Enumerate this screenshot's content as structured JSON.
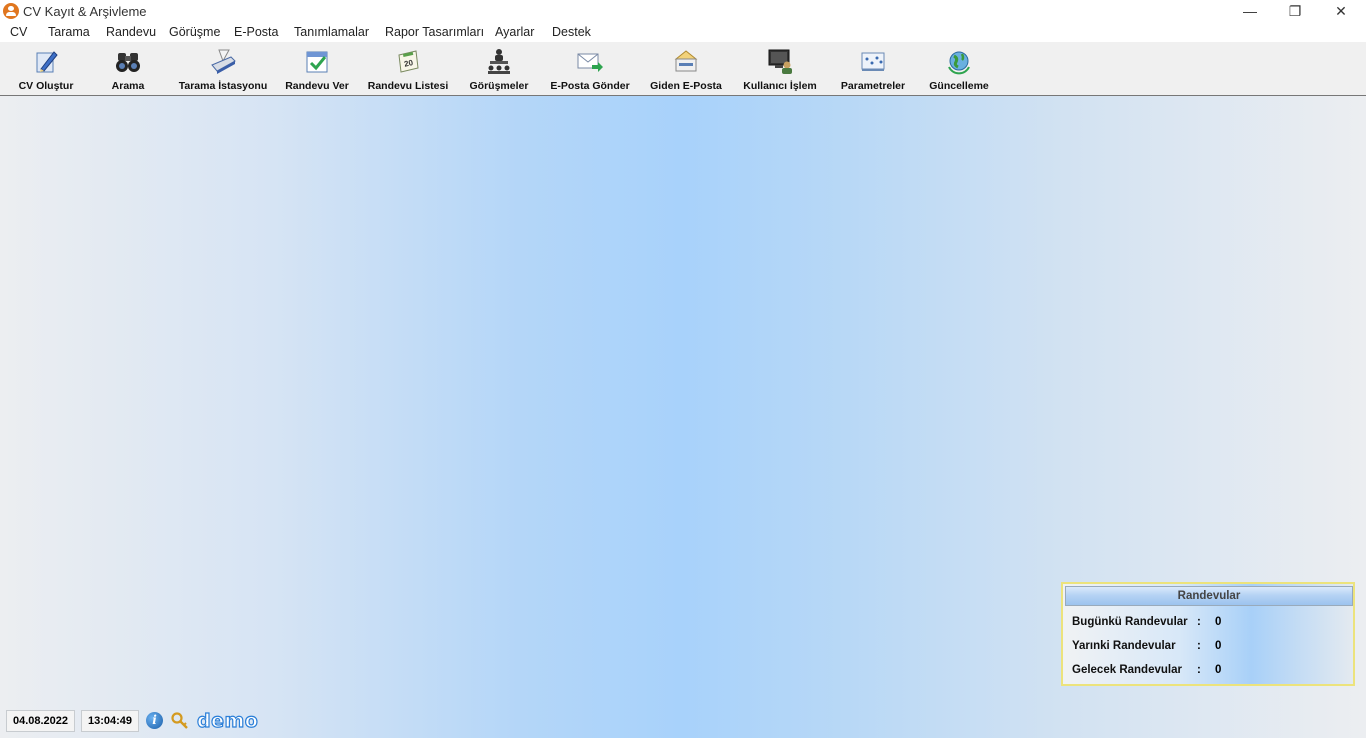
{
  "window": {
    "title": "CV Kayıt & Arşivleme",
    "minimize": "—",
    "restore": "❐",
    "close": "✕"
  },
  "menu": [
    "CV",
    "Tarama",
    "Randevu",
    "Görüşme",
    "E-Posta",
    "Tanımlamalar",
    "Rapor Tasarımları",
    "Ayarlar",
    "Destek"
  ],
  "toolbar": [
    {
      "label": "CV Oluştur",
      "icon": "pencil-doc-icon"
    },
    {
      "label": "Arama",
      "icon": "binoculars-icon"
    },
    {
      "label": "Tarama İstasyonu",
      "icon": "scanner-icon"
    },
    {
      "label": "Randevu Ver",
      "icon": "calendar-check-icon"
    },
    {
      "label": "Randevu Listesi",
      "icon": "calendar-list-icon"
    },
    {
      "label": "Görüşmeler",
      "icon": "meeting-icon"
    },
    {
      "label": "E-Posta Gönder",
      "icon": "mail-send-icon"
    },
    {
      "label": "Giden E-Posta",
      "icon": "mail-outbox-icon"
    },
    {
      "label": "Kullanıcı İşlem",
      "icon": "user-computer-icon"
    },
    {
      "label": "Parametreler",
      "icon": "parameters-icon"
    },
    {
      "label": "Güncelleme",
      "icon": "globe-update-icon"
    }
  ],
  "appointments": {
    "title": "Randevular",
    "rows": [
      {
        "label": "Bugünkü Randevular",
        "sep": ":",
        "value": "0"
      },
      {
        "label": "Yarınki Randevular",
        "sep": ":",
        "value": "0"
      },
      {
        "label": "Gelecek Randevular",
        "sep": ":",
        "value": "0"
      }
    ]
  },
  "status": {
    "date": "04.08.2022",
    "time": "13:04:49",
    "info_glyph": "i",
    "logo_text": "demo"
  },
  "colors": {
    "accent": "#e0761f",
    "workspace_center": "#a8d2fb",
    "panel_border": "#ece37c"
  }
}
